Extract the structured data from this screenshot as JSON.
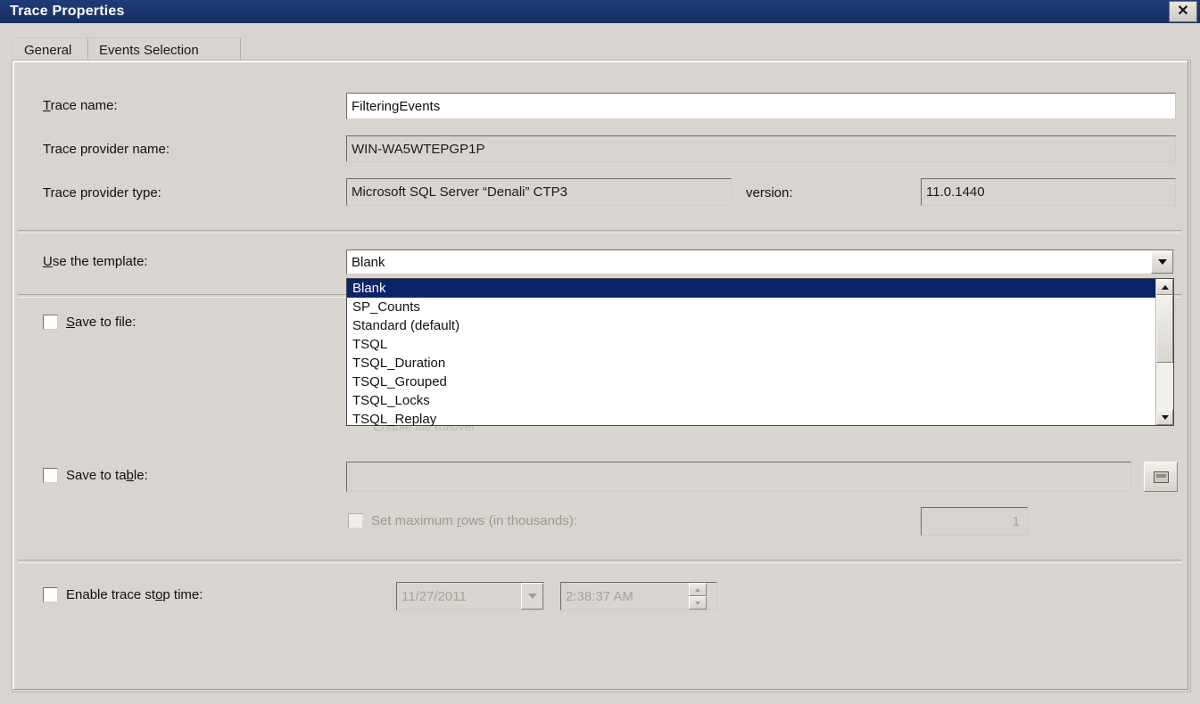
{
  "window": {
    "title": "Trace Properties",
    "close_label": "✕"
  },
  "tabs": [
    {
      "label": "General",
      "active": true
    },
    {
      "label": "Events Selection",
      "active": false
    }
  ],
  "form": {
    "trace_name": {
      "label_pre": "",
      "label_accel": "T",
      "label_post": "race name:",
      "value": "FilteringEvents"
    },
    "trace_provider_name": {
      "label": "Trace provider name:",
      "value": "WIN-WA5WTEPGP1P"
    },
    "trace_provider_type": {
      "label": "Trace provider type:",
      "value": "Microsoft SQL Server “Denali” CTP3"
    },
    "version": {
      "label": "version:",
      "value": "11.0.1440"
    },
    "use_template": {
      "label_accel": "U",
      "label_post": "se the template:",
      "selected": "Blank",
      "options": [
        "Blank",
        "SP_Counts",
        "Standard (default)",
        "TSQL",
        "TSQL_Duration",
        "TSQL_Grouped",
        "TSQL_Locks",
        "TSQL_Replay"
      ]
    },
    "save_to_file": {
      "label_pre": "",
      "label_accel": "S",
      "label_post": "ave to file:",
      "checked": false,
      "value": ""
    },
    "hidden_rollover": {
      "label": "Enable file rollover",
      "checked": false
    },
    "save_to_table": {
      "label_pre": "Save to ta",
      "label_accel": "b",
      "label_post": "le:",
      "checked": false,
      "value": ""
    },
    "set_max_rows": {
      "label_pre": "Set maximum ",
      "label_accel": "r",
      "label_post": "ows (in thousands):",
      "checked": false,
      "disabled": true,
      "value": "1"
    },
    "enable_stop_time": {
      "label_pre": "Enable trace st",
      "label_accel": "o",
      "label_post": "p time:",
      "checked": false,
      "date_value": "11/27/2011",
      "time_value": "2:38:37 AM"
    }
  },
  "icons": {
    "browse": "browse-icon",
    "chevron_down": "chevron-down-icon",
    "scroll_up": "scroll-up-icon",
    "scroll_down": "scroll-down-icon"
  },
  "colors": {
    "titlebar": "#1b3570",
    "selection": "#0a246a",
    "face": "#d8d5d0",
    "disabled_text": "#a5a19a"
  }
}
